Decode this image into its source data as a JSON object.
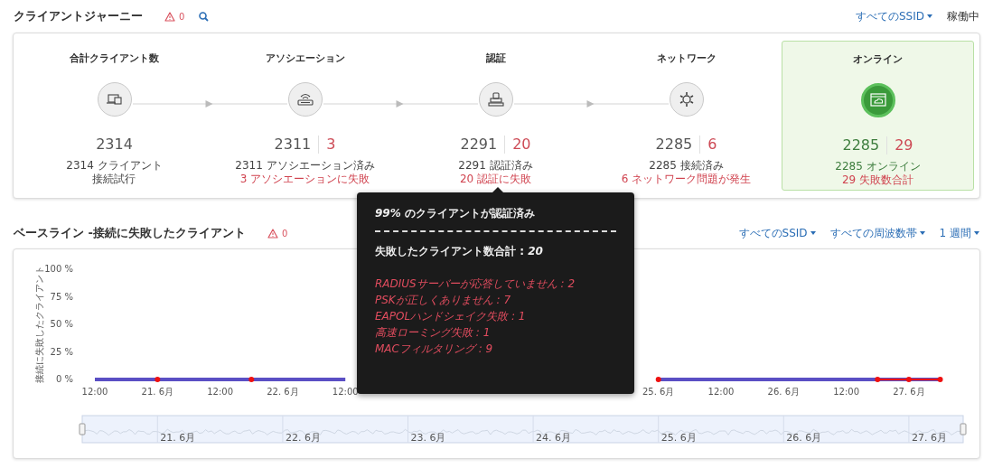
{
  "journey": {
    "title": "クライアントジャーニー",
    "alert_count": "0",
    "ssid_filter": "すべてのSSID",
    "status": "稼働中",
    "stages": [
      {
        "title": "合計クライアント数",
        "count": "2314",
        "highlighted": false,
        "lines": [
          {
            "text": "2314 クライアント",
            "kind": "normal"
          },
          {
            "text": "接続試行",
            "kind": "normal"
          }
        ]
      },
      {
        "title": "アソシエーション",
        "count": "2311",
        "failed": "3",
        "highlighted": false,
        "lines": [
          {
            "text": "2311 アソシエーション済み",
            "kind": "normal"
          },
          {
            "text": "3 アソシエーションに失敗",
            "kind": "error"
          }
        ]
      },
      {
        "title": "認証",
        "count": "2291",
        "failed": "20",
        "highlighted": false,
        "lines": [
          {
            "text": "2291 認証済み",
            "kind": "normal"
          },
          {
            "text": "20 認証に失敗",
            "kind": "error"
          }
        ]
      },
      {
        "title": "ネットワーク",
        "count": "2285",
        "failed": "6",
        "highlighted": false,
        "lines": [
          {
            "text": "2285 接続済み",
            "kind": "normal"
          },
          {
            "text": "6 ネットワーク問題が発生",
            "kind": "error"
          }
        ]
      },
      {
        "title": "オンライン",
        "count": "2285",
        "failed": "29",
        "highlighted": true,
        "lines": [
          {
            "text": "2285 オンライン",
            "kind": "success"
          },
          {
            "text": "29 失敗数合計",
            "kind": "error"
          }
        ]
      }
    ]
  },
  "tooltip": {
    "title": "*99%* のクライアントが認証済み",
    "total": "失敗したクライアント数合計 : *20*",
    "reasons": [
      "RADIUSサーバーが応答していません : 2",
      "PSKが正しくありません : 7",
      "EAPOLハンドシェイク失敗 : 1",
      "高速ローミング失敗 : 1",
      "MACフィルタリング : 9"
    ]
  },
  "baseline": {
    "title": "ベースライン -接続に失敗したクライアント",
    "alert_count": "0",
    "filters": [
      "すべてのSSID",
      "すべての周波数帯",
      "1 週間"
    ],
    "chart_data": {
      "type": "line",
      "ylabel": "接続に失敗したクライアント",
      "ylim": [
        0,
        100
      ],
      "yticks": [
        {
          "value": 0,
          "label": "0 %"
        },
        {
          "value": 25,
          "label": "25 %"
        },
        {
          "value": 50,
          "label": "50 %"
        },
        {
          "value": 75,
          "label": "75 %"
        },
        {
          "value": 100,
          "label": "100 %"
        }
      ],
      "categories": [
        "12:00",
        null,
        "21. 6月",
        null,
        "12:00",
        null,
        "22. 6月",
        null,
        "12:00",
        null,
        null,
        null,
        null,
        null,
        null,
        null,
        null,
        null,
        "25. 6月",
        null,
        "12:00",
        null,
        "26. 6月",
        null,
        "12:00",
        null,
        "27. 6月",
        null
      ],
      "series": [
        {
          "color": "#5a4fc4",
          "values": [
            0,
            0,
            0,
            0,
            0,
            0,
            0,
            0,
            0,
            null,
            null,
            null,
            null,
            null,
            null,
            null,
            null,
            null,
            0,
            0,
            0,
            0,
            0,
            0,
            0,
            0,
            0,
            0
          ]
        },
        {
          "color": "#ee1111",
          "marker": "circle",
          "values": [
            null,
            null,
            0,
            null,
            null,
            0,
            null,
            null,
            null,
            null,
            null,
            null,
            null,
            null,
            null,
            null,
            null,
            null,
            0,
            null,
            null,
            null,
            null,
            null,
            null,
            0,
            0,
            0
          ]
        }
      ]
    },
    "navigator_labels": [
      "21. 6月",
      "22. 6月",
      "23. 6月",
      "24. 6月",
      "25. 6月",
      "26. 6月",
      "27. 6月"
    ]
  }
}
